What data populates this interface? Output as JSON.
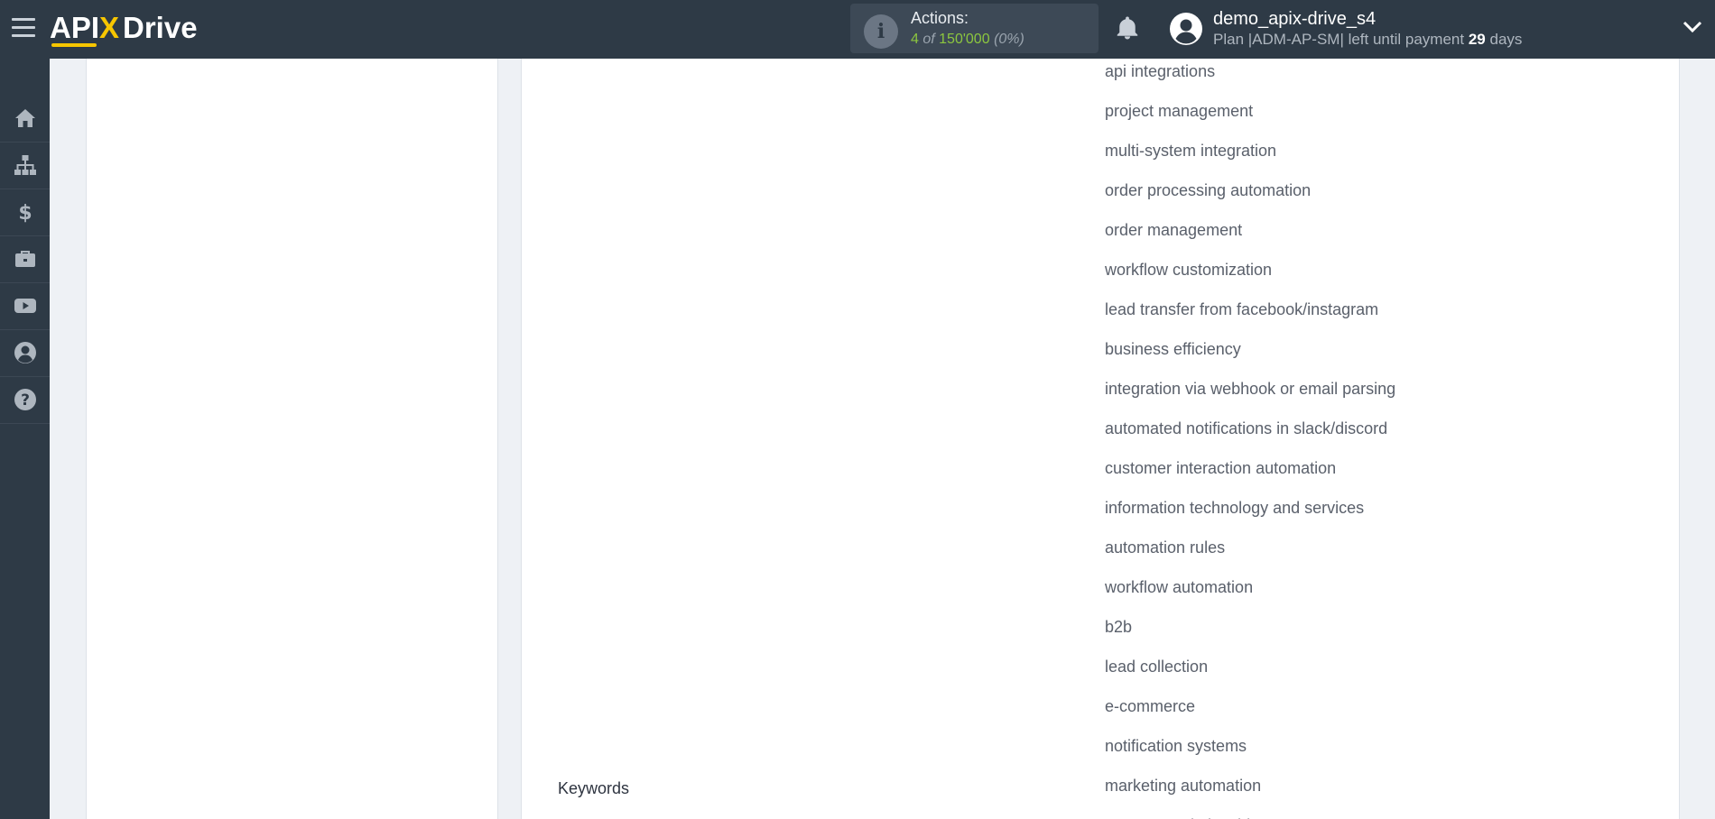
{
  "header": {
    "logo_text": "APIXDrive",
    "actions_label": "Actions:",
    "actions_used": "4",
    "actions_of": "of",
    "actions_total": "150'000",
    "actions_percent": "(0%)",
    "username": "demo_apix-drive_s4",
    "plan_prefix": "Plan |ADM-AP-SM| left until payment",
    "plan_days": "29",
    "plan_suffix": "days"
  },
  "sidebar": {
    "items": [
      {
        "icon": "home-icon"
      },
      {
        "icon": "sitemap-icon"
      },
      {
        "icon": "dollar-icon"
      },
      {
        "icon": "briefcase-icon"
      },
      {
        "icon": "youtube-icon"
      },
      {
        "icon": "user-circle-icon"
      },
      {
        "icon": "help-icon"
      }
    ]
  },
  "main": {
    "values": [
      "api integrations",
      "project management",
      "multi-system integration",
      "order processing automation",
      "order management",
      "workflow customization",
      "lead transfer from facebook/instagram",
      "business efficiency",
      "integration via webhook or email parsing",
      "automated notifications in slack/discord",
      "customer interaction automation",
      "information technology and services",
      "automation rules",
      "workflow automation",
      "b2b",
      "lead collection",
      "e-commerce",
      "notification systems",
      "marketing automation",
      "customer relationship management"
    ],
    "field_label": "Keywords"
  },
  "colors": {
    "topbar": "#2e3a46",
    "accent_green": "#8cc63f",
    "logo_yellow": "#f7c600",
    "page_bg": "#eef1f5"
  }
}
